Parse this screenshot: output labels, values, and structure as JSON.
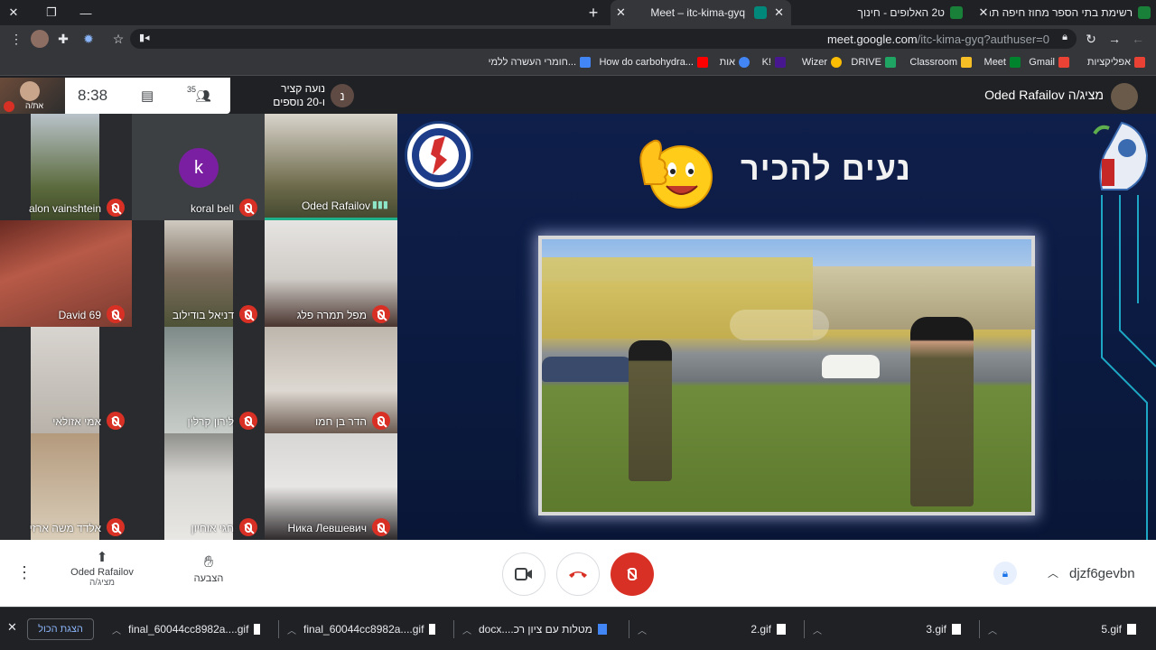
{
  "browser": {
    "tabs": [
      {
        "label": "רשימת בתי הספר מחוז חיפה תח",
        "color": "#188038",
        "active": false
      },
      {
        "label": "ט2 האלופים - חינוך",
        "color": "#188038",
        "active": false
      },
      {
        "label": "Meet – itc-kima-gyq",
        "color": "#00897b",
        "active": true
      }
    ],
    "url_host": "meet.google.com",
    "url_path": "/itc-kima-gyq?authuser=0",
    "bookmarks": [
      {
        "label": "אפליקציות",
        "color": "#e94235"
      },
      {
        "label": "Gmail",
        "color": "#ea4335"
      },
      {
        "label": "Meet",
        "color": "#00832d"
      },
      {
        "label": "Classroom",
        "color": "#f6bf26"
      },
      {
        "label": "DRIVE",
        "color": "#1fa463"
      },
      {
        "label": "Wizer",
        "color": "#fbbc04"
      },
      {
        "label": "K!",
        "color": "#46178f"
      },
      {
        "label": "אות",
        "color": "#4285f4"
      },
      {
        "label": "How do carbohydra...",
        "color": "#ff0000"
      },
      {
        "label": "חומרי העשרה ללמי...",
        "color": "#4285f4"
      }
    ]
  },
  "meet": {
    "clock": "8:38",
    "people_count": "35",
    "self_label": "את/ה",
    "speaker_line1": "נועה קציר",
    "speaker_line2": "ו-20 נוספים",
    "speaker_initial": "נ",
    "presenter": "Oded Rafailov מציג/ה",
    "participants": [
      {
        "name": "alon vainshtein",
        "muted": true
      },
      {
        "name": "koral bell",
        "muted": true,
        "initial": "k"
      },
      {
        "name": "Oded Rafailov",
        "muted": false
      },
      {
        "name": "David 69",
        "muted": true
      },
      {
        "name": "דניאל בודילוב",
        "muted": true
      },
      {
        "name": "מפל תמרה פלג",
        "muted": true
      },
      {
        "name": "אמי אזולאי",
        "muted": true
      },
      {
        "name": "לירון קרלין",
        "muted": true
      },
      {
        "name": "הדר בן חמו",
        "muted": true
      },
      {
        "name": "אלדד משה ארזי",
        "muted": true
      },
      {
        "name": "חגי אוחיון",
        "muted": true
      },
      {
        "name": "Ника Левшевич",
        "muted": true
      }
    ],
    "slide_title": "נעים להכיר",
    "presenting_name": "Oded Rafailov",
    "presenting_role": "מציג/ה",
    "raise_hand": "הצבעה",
    "meeting_code": "djzf6gevbn",
    "accent_red": "#d93025"
  },
  "downloads": {
    "show_all": "הצגת הכול",
    "items": [
      "5.gif",
      "3.gif",
      "2.gif",
      "מטלות עם ציון רכ....docx",
      "final_60044cc8982a....gif",
      "final_60044cc8982a....gif"
    ]
  }
}
